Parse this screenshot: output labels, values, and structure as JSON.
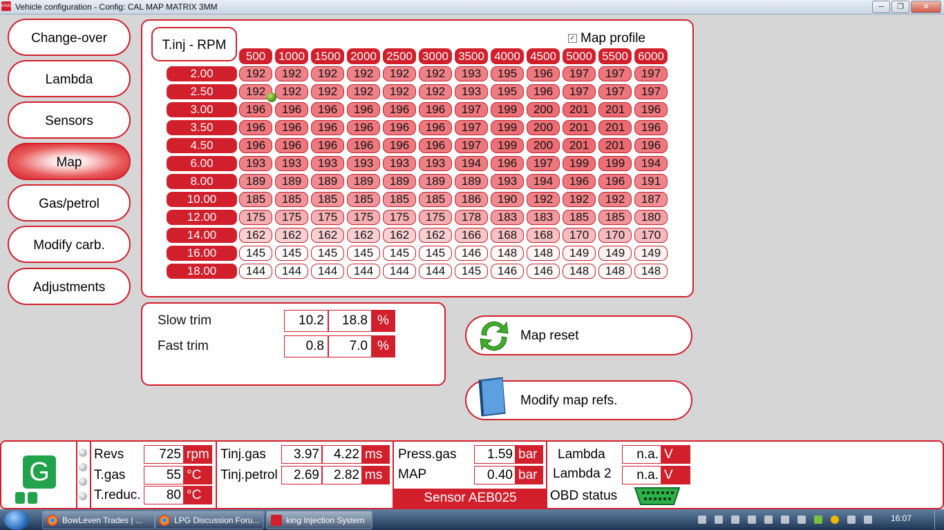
{
  "window": {
    "title": "Vehicle configuration - Config: CAL MAP MATRIX 3MM",
    "app_icon": "KING",
    "minimize": "─",
    "restore": "❐",
    "close": "✕"
  },
  "nav": [
    "Change-over",
    "Lambda",
    "Sensors",
    "Map",
    "Gas/petrol",
    "Modify carb.",
    "Adjustments"
  ],
  "nav_active": "Map",
  "map": {
    "title": "T.inj - RPM",
    "profile_checked": true,
    "profile_check_mark": "✓",
    "profile_label": "Map profile",
    "rpm": [
      "500",
      "1000",
      "1500",
      "2000",
      "2500",
      "3000",
      "3500",
      "4000",
      "4500",
      "5000",
      "5500",
      "6000"
    ],
    "tinj": [
      "2.00",
      "2.50",
      "3.00",
      "3.50",
      "4.50",
      "6.00",
      "8.00",
      "10.00",
      "12.00",
      "14.00",
      "16.00",
      "18.00"
    ],
    "values": [
      [
        192,
        192,
        192,
        192,
        192,
        192,
        193,
        195,
        196,
        197,
        197,
        197
      ],
      [
        192,
        192,
        192,
        192,
        192,
        192,
        193,
        195,
        196,
        197,
        197,
        197
      ],
      [
        196,
        196,
        196,
        196,
        196,
        196,
        197,
        199,
        200,
        201,
        201,
        196
      ],
      [
        196,
        196,
        196,
        196,
        196,
        196,
        197,
        199,
        200,
        201,
        201,
        196
      ],
      [
        196,
        196,
        196,
        196,
        196,
        196,
        197,
        199,
        200,
        201,
        201,
        196
      ],
      [
        193,
        193,
        193,
        193,
        193,
        193,
        194,
        196,
        197,
        199,
        199,
        194
      ],
      [
        189,
        189,
        189,
        189,
        189,
        189,
        189,
        193,
        194,
        196,
        196,
        191
      ],
      [
        185,
        185,
        185,
        185,
        185,
        185,
        186,
        190,
        192,
        192,
        192,
        187
      ],
      [
        175,
        175,
        175,
        175,
        175,
        175,
        178,
        183,
        183,
        185,
        185,
        180
      ],
      [
        162,
        162,
        162,
        162,
        162,
        162,
        166,
        168,
        168,
        170,
        170,
        170
      ],
      [
        145,
        145,
        145,
        145,
        145,
        145,
        146,
        148,
        148,
        149,
        149,
        149
      ],
      [
        144,
        144,
        144,
        144,
        144,
        144,
        145,
        146,
        146,
        148,
        148,
        148
      ]
    ]
  },
  "trim": {
    "slow": {
      "label": "Slow trim",
      "v1": "10.2",
      "v2": "18.8",
      "unit": "%"
    },
    "fast": {
      "label": "Fast trim",
      "v1": "0.8",
      "v2": "7.0",
      "unit": "%"
    }
  },
  "buttons": {
    "map_reset": "Map reset",
    "modify_refs": "Modify map refs."
  },
  "status": {
    "mode_letter": "G",
    "revs": {
      "label": "Revs",
      "value": "725",
      "unit": "rpm"
    },
    "tgas": {
      "label": "T.gas",
      "value": "55",
      "unit": "°C"
    },
    "treduc": {
      "label": "T.reduc.",
      "value": "80",
      "unit": "°C"
    },
    "tinj_gas": {
      "label": "Tinj.gas",
      "v1": "3.97",
      "v2": "4.22",
      "unit": "ms"
    },
    "tinj_petrol": {
      "label": "Tinj.petrol",
      "v1": "2.69",
      "v2": "2.82",
      "unit": "ms"
    },
    "press_gas": {
      "label": "Press.gas",
      "value": "1.59",
      "unit": "bar"
    },
    "map": {
      "label": "MAP",
      "value": "0.40",
      "unit": "bar"
    },
    "sensor": "Sensor AEB025",
    "lambda": {
      "label": "Lambda",
      "value": "n.a.",
      "unit": "V"
    },
    "lambda2": {
      "label": "Lambda 2",
      "value": "n.a.",
      "unit": "V"
    },
    "obd": {
      "label": "OBD status"
    }
  },
  "taskbar": {
    "tasks": [
      "BowLeven Trades | ...",
      "LPG Discussion Foru...",
      "king Injection System"
    ],
    "clock": "16:07"
  },
  "colors": {
    "accent": "#d21f2c",
    "cell_high": "#ec6b72",
    "cell_low": "#ffffff",
    "status_green": "#22a24a"
  }
}
